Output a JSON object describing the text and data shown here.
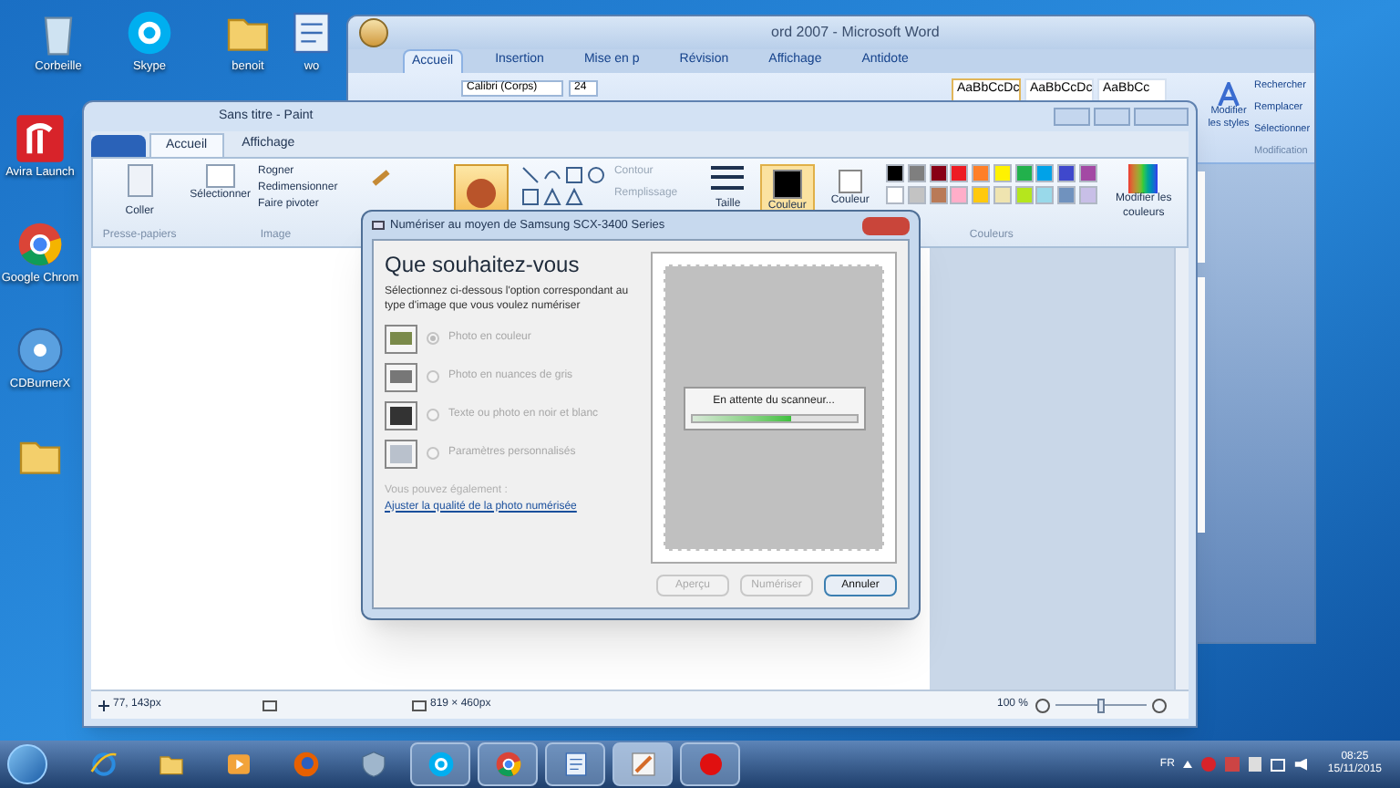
{
  "desktop_icons": [
    {
      "label": "Corbeille",
      "kind": "bin"
    },
    {
      "label": "Skype",
      "kind": "skype"
    },
    {
      "label": "benoit",
      "kind": "folder"
    },
    {
      "label": "wo",
      "kind": "doc"
    },
    {
      "label": "Avira Launch",
      "kind": "avira"
    },
    {
      "label": "Google Chrom",
      "kind": "chrome"
    },
    {
      "label": "CDBurnerX",
      "kind": "disc"
    },
    {
      "kind": "folder"
    }
  ],
  "word": {
    "title": "ord 2007 - Microsoft Word",
    "tabs": [
      {
        "label": "Accueil",
        "selected": true
      },
      {
        "label": "Insertion",
        "selected": false
      },
      {
        "label": "Mise en p",
        "selected": false
      },
      {
        "label": "Révision",
        "selected": false
      },
      {
        "label": "Affichage",
        "selected": false
      },
      {
        "label": "Antidote",
        "selected": false
      }
    ],
    "font": "Calibri (Corps)",
    "font_size": "24",
    "styles": [
      "AaBbCcDc",
      "AaBbCcDc",
      "AaBbCc"
    ],
    "change_styles": "Modifier les styles",
    "editing": [
      "Rechercher",
      "Remplacer",
      "Sélectionner"
    ],
    "editing_group": "Modification"
  },
  "paint": {
    "title": "Sans titre - Paint",
    "tabs": [
      {
        "label": "Accueil",
        "selected": true
      },
      {
        "label": "Affichage",
        "selected": false
      }
    ],
    "paste": "Coller",
    "clipboard_group": "Presse-papiers",
    "select": "Sélectionner",
    "image_actions": [
      "Rogner",
      "Redimensionner",
      "Faire pivoter"
    ],
    "image_group": "Image",
    "outline": "Contour",
    "fill": "Remplissage",
    "size": "Taille",
    "color1": "Couleur",
    "color2": "Couleur",
    "palette": [
      {
        "color": "#000000"
      },
      {
        "color": "#7f7f7f"
      },
      {
        "color": "#880015"
      },
      {
        "color": "#ed1c24"
      },
      {
        "color": "#ff7f27"
      },
      {
        "color": "#fff200"
      },
      {
        "color": "#22b14c"
      },
      {
        "color": "#00a2e8"
      },
      {
        "color": "#3f48cc"
      },
      {
        "color": "#a349a4"
      },
      {
        "color": "#ffffff"
      },
      {
        "color": "#c3c3c3"
      },
      {
        "color": "#b97a57"
      },
      {
        "color": "#ffaec9"
      },
      {
        "color": "#ffc90e"
      },
      {
        "color": "#efe4b0"
      },
      {
        "color": "#b5e61d"
      },
      {
        "color": "#99d9ea"
      },
      {
        "color": "#7092be"
      },
      {
        "color": "#c8bfe7"
      }
    ],
    "edit_colors": "Modifier les couleurs",
    "colors_group": "Couleurs",
    "status": {
      "cursor": "77, 143px",
      "dimensions": "819 × 460px",
      "zoom": "100 %",
      "zoom_slider": {
        "level": 0.5
      }
    }
  },
  "dialog": {
    "title": "Numériser au moyen de Samsung SCX-3400 Series",
    "heading": "Que souhaitez-vous",
    "instructions": "Sélectionnez ci-dessous l'option correspondant au type d'image que vous voulez numériser",
    "options": [
      {
        "label": "Photo en couleur",
        "kind": "color",
        "selected": true,
        "disabled": true
      },
      {
        "label": "Photo en nuances de gris",
        "kind": "gray",
        "selected": false,
        "disabled": true
      },
      {
        "label": "Texte ou photo en noir et blanc",
        "kind": "text",
        "selected": false,
        "disabled": true
      },
      {
        "label": "Paramètres personnalisés",
        "kind": "custom",
        "selected": false,
        "disabled": true
      }
    ],
    "also": "Vous pouvez également :",
    "link": "Ajuster la qualité de la photo numérisée",
    "waiting": "En attente du scanneur...",
    "progress": {
      "level": 0.6
    },
    "buttons": [
      {
        "label": "Aperçu",
        "disabled": true,
        "default": false
      },
      {
        "label": "Numériser",
        "disabled": true,
        "default": false
      },
      {
        "label": "Annuler",
        "disabled": false,
        "default": true
      }
    ]
  },
  "taskbar": {
    "apps": [
      {
        "kind": "ie",
        "selected": false,
        "running": false
      },
      {
        "kind": "explorer",
        "selected": false,
        "running": false
      },
      {
        "kind": "media",
        "selected": false,
        "running": false
      },
      {
        "kind": "firefox",
        "selected": false,
        "running": false
      },
      {
        "kind": "shield",
        "selected": false,
        "running": false
      },
      {
        "kind": "skype",
        "selected": false,
        "running": true
      },
      {
        "kind": "chrome",
        "selected": false,
        "running": true
      },
      {
        "kind": "word",
        "selected": false,
        "running": true
      },
      {
        "kind": "paint",
        "selected": true,
        "running": true
      },
      {
        "kind": "record",
        "selected": false,
        "running": true
      }
    ],
    "language": "FR",
    "time": "08:25",
    "date": "15/11/2015"
  }
}
